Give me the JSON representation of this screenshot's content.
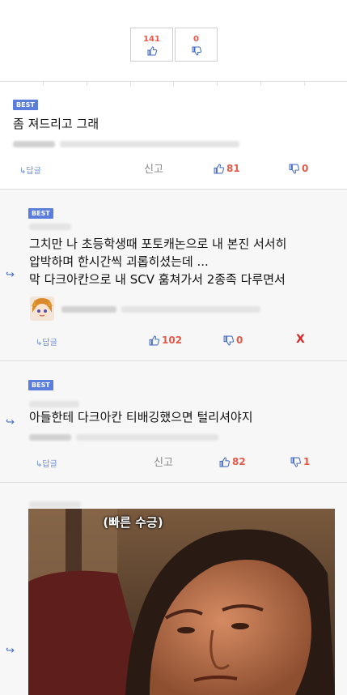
{
  "post_vote": {
    "up": "141",
    "down": "0"
  },
  "comments": [
    {
      "badge": "BEST",
      "text": "좀 져드리고 그래",
      "reply_label": "↳답글",
      "report_label": "신고",
      "likes": "81",
      "dislikes": "0"
    },
    {
      "badge": "BEST",
      "lines": [
        "그치만 나 초등학생때 포토캐논으로 내 본진 서서히",
        "압박하며 한시간씩 괴롭히셨는데 ...",
        "막 다크아칸으로 내 SCV 훔쳐가서 2종족 다루면서"
      ],
      "reply_label": "↳답글",
      "likes": "102",
      "dislikes": "0",
      "delete_label": "X"
    },
    {
      "badge": "BEST",
      "text": "아들한테 다크아칸 티배깅했으면 털리셔야지",
      "reply_label": "↳답글",
      "report_label": "신고",
      "likes": "82",
      "dislikes": "1"
    },
    {
      "image_caption": "(빠른 수긍)"
    }
  ],
  "colors": {
    "accent_red": "#e25a4a",
    "badge_blue": "#5b7ddb",
    "link_blue": "#6e8fcf"
  },
  "icons": {
    "like": "thumbs-up-icon",
    "dislike": "thumbs-down-icon",
    "reply": "reply-arrow-icon"
  }
}
